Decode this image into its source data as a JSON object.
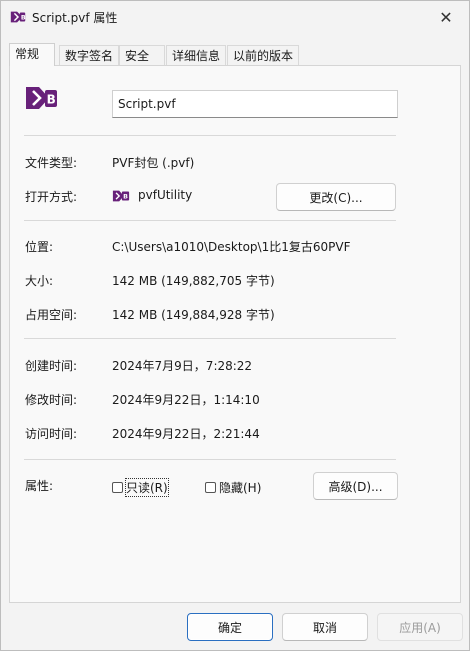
{
  "window": {
    "title": "Script.pvf 属性",
    "close_symbol": "✕"
  },
  "tabs": [
    {
      "label": "常规",
      "active": true
    },
    {
      "label": "数字签名",
      "active": false
    },
    {
      "label": "安全",
      "active": false
    },
    {
      "label": "详细信息",
      "active": false
    },
    {
      "label": "以前的版本",
      "active": false
    }
  ],
  "general": {
    "file_name": "Script.pvf",
    "file_type_label": "文件类型:",
    "file_type_value": "PVF封包 (.pvf)",
    "opens_with_label": "打开方式:",
    "opens_with_value": "pvfUtility",
    "change_button": "更改(C)...",
    "location_label": "位置:",
    "location_value": "C:\\Users\\a1010\\Desktop\\1比1复古60PVF",
    "size_label": "大小:",
    "size_value": "142 MB (149,882,705 字节)",
    "size_on_disk_label": "占用空间:",
    "size_on_disk_value": "142 MB (149,884,928 字节)",
    "created_label": "创建时间:",
    "created_value": "2024年7月9日，7:28:22",
    "modified_label": "修改时间:",
    "modified_value": "2024年9月22日，1:14:10",
    "accessed_label": "访问时间:",
    "accessed_value": "2024年9月22日，2:21:44",
    "attributes_label": "属性:",
    "readonly_label": "只读(R)",
    "hidden_label": "隐藏(H)",
    "advanced_button": "高级(D)..."
  },
  "footer": {
    "ok": "确定",
    "cancel": "取消",
    "apply": "应用(A)"
  },
  "colors": {
    "accent": "#2a6fc1",
    "vs_purple": "#68217a"
  }
}
